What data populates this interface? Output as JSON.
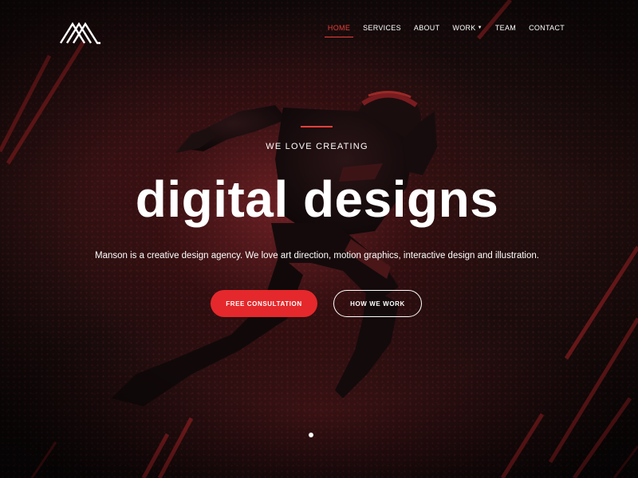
{
  "nav": {
    "items": [
      {
        "label": "HOME",
        "active": true
      },
      {
        "label": "SERVICES",
        "active": false
      },
      {
        "label": "ABOUT",
        "active": false
      },
      {
        "label": "WORK",
        "active": false,
        "dropdown": true
      },
      {
        "label": "TEAM",
        "active": false
      },
      {
        "label": "CONTACT",
        "active": false
      }
    ]
  },
  "hero": {
    "eyebrow": "WE LOVE CREATING",
    "headline": "digital designs",
    "tagline": "Manson is a creative design agency. We love art direction, motion graphics, interactive design and illustration.",
    "primary_button": "FREE CONSULTATION",
    "secondary_button": "HOW WE WORK"
  },
  "icons": {
    "logo": "mountain-logo-icon",
    "dropdown": "caret-down-icon",
    "slider_dot": "slider-dot"
  },
  "colors": {
    "accent": "#e8413a",
    "button_primary": "#e5282b",
    "text": "#ffffff",
    "background": "#1a0c0c"
  }
}
